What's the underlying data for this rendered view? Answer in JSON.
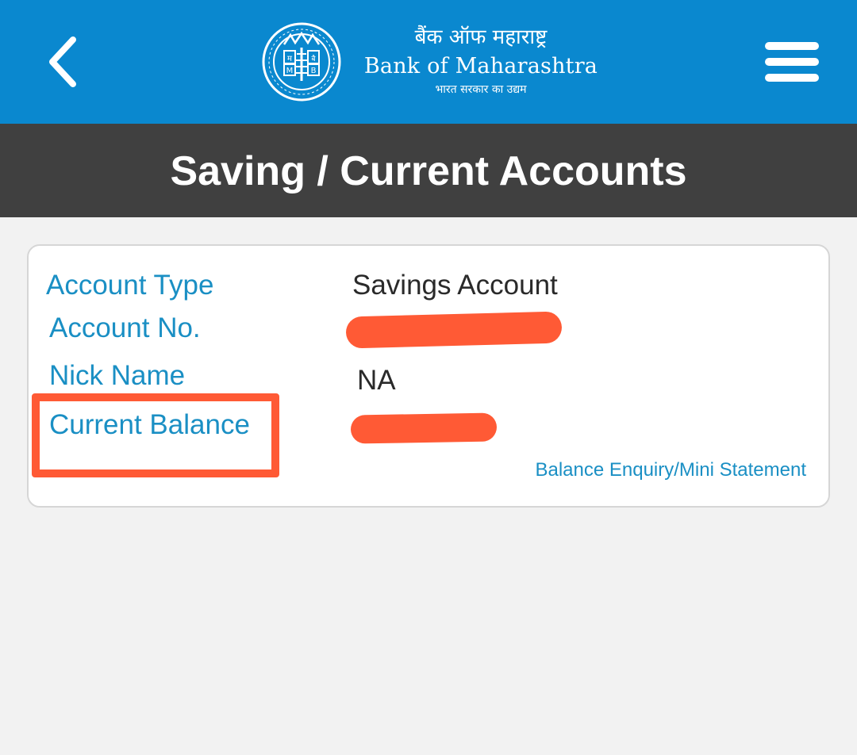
{
  "header": {
    "brand": {
      "hindi_name": "बैंक ऑफ महाराष्ट्र",
      "english_name": "Bank of Maharashtra",
      "tagline": "भारत सरकार का उद्यम",
      "emblem_letters": [
        "म",
        "M",
        "बै",
        "B"
      ]
    },
    "back_icon": "chevron-left-icon",
    "menu_icon": "hamburger-menu-icon"
  },
  "page": {
    "title": "Saving / Current Accounts"
  },
  "account": {
    "fields": [
      {
        "label": "Account Type",
        "value": "Savings Account"
      },
      {
        "label": "Account No.",
        "value": "",
        "redacted": true
      },
      {
        "label": "Nick Name",
        "value": "NA"
      },
      {
        "label": "Current Balance",
        "value": "",
        "redacted": true,
        "highlighted": true
      }
    ],
    "link": "Balance Enquiry/Mini Statement"
  },
  "colors": {
    "app_bar": "#0a88cf",
    "title_bar": "#404040",
    "label_text": "#1a8fc4",
    "redaction_and_highlight": "#ff5a35",
    "background": "#f2f2f2"
  }
}
